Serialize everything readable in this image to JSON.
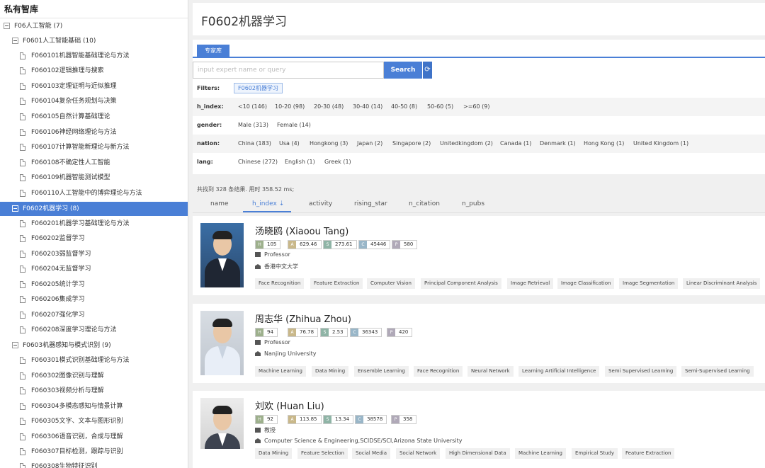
{
  "sidebar": {
    "title": "私有智库",
    "items": [
      {
        "label": "F06人工智能 (7)",
        "type": "folder"
      },
      {
        "label": "F0601人工智能基础 (10)",
        "type": "folder"
      },
      {
        "label": "F060101机器智能基础理论与方法",
        "type": "doc"
      },
      {
        "label": "F060102逻辑推理与搜索",
        "type": "doc"
      },
      {
        "label": "F060103定理证明与近似推理",
        "type": "doc"
      },
      {
        "label": "F060104复杂任务规划与决策",
        "type": "doc"
      },
      {
        "label": "F060105自然计算基础理论",
        "type": "doc"
      },
      {
        "label": "F060106神经网络理论与方法",
        "type": "doc"
      },
      {
        "label": "F060107计算智能新理论与新方法",
        "type": "doc"
      },
      {
        "label": "F060108不确定性人工智能",
        "type": "doc"
      },
      {
        "label": "F060109机器智能测试模型",
        "type": "doc"
      },
      {
        "label": "F060110人工智能中的博弈理论与方法",
        "type": "doc"
      },
      {
        "label": "F0602机器学习 (8)",
        "type": "folder",
        "selected": true
      },
      {
        "label": "F060201机器学习基础理论与方法",
        "type": "doc"
      },
      {
        "label": "F060202监督学习",
        "type": "doc"
      },
      {
        "label": "F060203弱监督学习",
        "type": "doc"
      },
      {
        "label": "F060204无监督学习",
        "type": "doc"
      },
      {
        "label": "F060205统计学习",
        "type": "doc"
      },
      {
        "label": "F060206集成学习",
        "type": "doc"
      },
      {
        "label": "F060207强化学习",
        "type": "doc"
      },
      {
        "label": "F060208深度学习理论与方法",
        "type": "doc"
      },
      {
        "label": "F0603机器感知与模式识别 (9)",
        "type": "folder"
      },
      {
        "label": "F060301模式识别基础理论与方法",
        "type": "doc"
      },
      {
        "label": "F060302图像识别与理解",
        "type": "doc"
      },
      {
        "label": "F060303视频分析与理解",
        "type": "doc"
      },
      {
        "label": "F060304多模态感知与情景计算",
        "type": "doc"
      },
      {
        "label": "F060305文字、文本与图形识别",
        "type": "doc"
      },
      {
        "label": "F060306语音识别，合成与理解",
        "type": "doc"
      },
      {
        "label": "F060307目标检测，跟踪与识别",
        "type": "doc"
      },
      {
        "label": "F060308生物特征识别",
        "type": "doc"
      }
    ]
  },
  "header": {
    "title": "F0602机器学习"
  },
  "search": {
    "tab_label": "专家库",
    "placeholder": "input expert name or query",
    "button_label": "Search",
    "refresh_icon": "refresh-icon"
  },
  "filters": {
    "filters_label": "Filters:",
    "active_chip": "F0602机器学习",
    "h_index": {
      "label": "h_index:",
      "options": [
        "<10 (146)",
        "10-20 (98)",
        "20-30 (48)",
        "30-40 (14)",
        "40-50 (8)",
        "50-60 (5)",
        ">=60 (9)"
      ]
    },
    "gender": {
      "label": "gender:",
      "options": [
        "Male (313)",
        "Female (14)"
      ]
    },
    "nation": {
      "label": "nation:",
      "options": [
        "China (183)",
        "Usa (4)",
        "Hongkong (3)",
        "Japan (2)",
        "Singapore (2)",
        "Unitedkingdom (2)",
        "Canada (1)",
        "Denmark (1)",
        "Hong Kong (1)",
        "United Kingdom (1)"
      ]
    },
    "lang": {
      "label": "lang:",
      "options": [
        "Chinese (272)",
        "English (1)",
        "Greek (1)"
      ]
    }
  },
  "results": {
    "summary": "共找到 328 条结果. 用时 358.52 ms;",
    "sort_tabs": [
      "name",
      "h_index",
      "activity",
      "rising_star",
      "n_citation",
      "n_pubs"
    ],
    "active_sort": "h_index",
    "sort_icon": "sort-desc-icon"
  },
  "experts": [
    {
      "name": "汤晓鸥 (Xiaoou Tang)",
      "h": "105",
      "a": "629.46",
      "s": "273.61",
      "c": "45446",
      "p": "580",
      "position": "Professor",
      "affiliation": "香港中文大学",
      "tags": [
        "Face Recognition",
        "Feature Extraction",
        "Computer Vision",
        "Principal Component Analysis",
        "Image Retrieval",
        "Image Classification",
        "Image Segmentation",
        "Linear Discriminant Analysis"
      ]
    },
    {
      "name": "周志华 (Zhihua Zhou)",
      "h": "94",
      "a": "76.78",
      "s": "2.53",
      "c": "36343",
      "p": "420",
      "position": "Professor",
      "affiliation": "Nanjing University",
      "tags": [
        "Machine Learning",
        "Data Mining",
        "Ensemble Learning",
        "Face Recognition",
        "Neural Network",
        "Learning Artificial Intelligence",
        "Semi Supervised Learning",
        "Semi-Supervised Learning"
      ]
    },
    {
      "name": "刘欢 (Huan Liu)",
      "h": "92",
      "a": "113.85",
      "s": "13.34",
      "c": "38578",
      "p": "358",
      "position": "教授",
      "affiliation": "Computer Science & Engineering,SCIDSE/SCI,Arizona State University",
      "tags": [
        "Data Mining",
        "Feature Selection",
        "Social Media",
        "Social Network",
        "High Dimensional Data",
        "Machine Learning",
        "Empirical Study",
        "Feature Extraction"
      ]
    }
  ]
}
